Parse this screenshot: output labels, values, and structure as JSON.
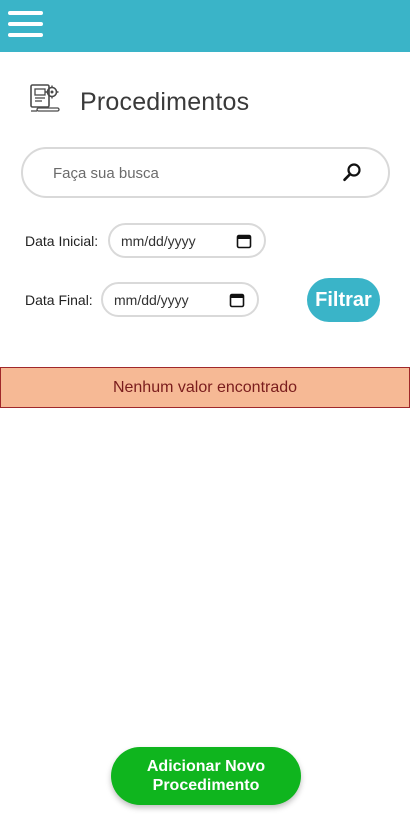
{
  "header": {
    "menu_icon": "hamburger-menu-icon",
    "color": "#3ab4c8"
  },
  "page": {
    "title": "Procedimentos",
    "title_icon": "procedures-document-gear-icon"
  },
  "search": {
    "placeholder": "Faça sua busca",
    "value": "",
    "icon": "search-icon"
  },
  "filters": {
    "start_label": "Data Inicial:",
    "start_value": "mm/dd/yyyy",
    "end_label": "Data Final:",
    "end_value": "mm/dd/yyyy",
    "filter_button": "Filtrar"
  },
  "results": {
    "empty_message": "Nenhum valor encontrado"
  },
  "actions": {
    "add_button": "Adicionar Novo Procedimento"
  },
  "colors": {
    "accent": "#3ab4c8",
    "add_button": "#0fb51e",
    "alert_bg": "#f6b995",
    "alert_text": "#7a1d1d"
  }
}
